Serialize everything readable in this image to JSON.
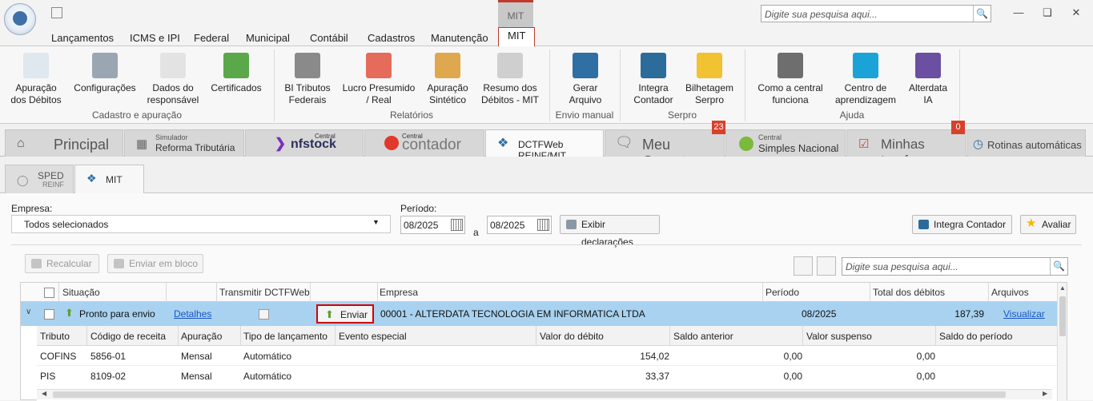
{
  "titlebar": {
    "search_placeholder": "Digite sua pesquisa aqui...",
    "context_tab": "MIT"
  },
  "menu": {
    "tabs": [
      "Lançamentos",
      "ICMS e IPI",
      "Federal",
      "Municipal",
      "Contábil",
      "Cadastros",
      "Manutenção",
      "MIT"
    ],
    "active": "MIT"
  },
  "ribbon": {
    "buttons": [
      {
        "l1": "Apuração",
        "l2": "dos Débitos",
        "icon": "document-nf-icon",
        "color": "#dfe7ef"
      },
      {
        "l1": "Configurações",
        "l2": "",
        "icon": "database-icon",
        "color": "#9aa6b2"
      },
      {
        "l1": "Dados do",
        "l2": "responsável",
        "icon": "document-icon",
        "color": "#e3e3e3"
      },
      {
        "l1": "Certificados",
        "l2": "",
        "icon": "certificate-icon",
        "color": "#5ba84a"
      },
      {
        "l1": "BI Tributos",
        "l2": "Federais",
        "icon": "bi-icon",
        "color": "#8a8a8a"
      },
      {
        "l1": "Lucro Presumido",
        "l2": "/ Real",
        "icon": "trend-chart-icon",
        "color": "#e56b5b"
      },
      {
        "l1": "Apuração",
        "l2": "Sintético",
        "icon": "edit-document-icon",
        "color": "#e0a84e"
      },
      {
        "l1": "Resumo dos",
        "l2": "Débitos - MIT",
        "icon": "documents-icon",
        "color": "#cfcfcf"
      },
      {
        "l1": "Gerar",
        "l2": "Arquivo",
        "icon": "reinf-logo-icon",
        "color": "#2f6fa3"
      },
      {
        "l1": "Integra",
        "l2": "Contador",
        "icon": "integra-icon",
        "color": "#2b6c9a"
      },
      {
        "l1": "Bilhetagem",
        "l2": "Serpro",
        "icon": "billing-icon",
        "color": "#f1c232"
      },
      {
        "l1": "Como a central",
        "l2": "funciona",
        "icon": "help-icon",
        "color": "#6e6e6e"
      },
      {
        "l1": "Centro de",
        "l2": "aprendizagem",
        "icon": "learning-icon",
        "color": "#1aa3d6"
      },
      {
        "l1": "Alterdata",
        "l2": "IA",
        "icon": "ai-icon",
        "color": "#6b4fa0"
      }
    ],
    "groups": [
      "Cadastro e apuração",
      "Relatórios",
      "Envio manual",
      "Serpro",
      "Ajuda"
    ]
  },
  "bigtabs": {
    "principal": "Principal",
    "simulador_small": "Simulador",
    "simulador": "Reforma Tributária",
    "nfstock_small": "Central",
    "nfstock": "nfstock",
    "contador_small": "Central",
    "contador": "contador",
    "dctf": "DCTFWeb REINF/MIT",
    "gerente": "Meu Gerente",
    "gerente_badge": "23",
    "simples_small": "Central",
    "simples": "Simples Nacional",
    "tarefas": "Minhas tarefas",
    "tarefas_badge": "0",
    "rotinas": "Rotinas automáticas"
  },
  "subtabs": {
    "sped1": "SPED",
    "sped2": "REINF",
    "mit": "MIT"
  },
  "filters": {
    "empresa_label": "Empresa:",
    "empresa_value": "Todos selecionados",
    "periodo_label": "Período:",
    "date_from": "08/2025",
    "sep": "a",
    "date_to": "08/2025",
    "exibir": "Exibir declarações",
    "integra": "Integra Contador",
    "avaliar": "Avaliar"
  },
  "toolbar": {
    "recalcular": "Recalcular",
    "enviar_bloco": "Enviar em bloco",
    "search_placeholder": "Digite sua pesquisa aqui..."
  },
  "grid": {
    "headers": [
      "Situação",
      "Transmitir DCTFWeb",
      "Empresa",
      "Período",
      "Total dos débitos",
      "Arquivos"
    ],
    "row": {
      "situacao": "Pronto para envio",
      "detalhes": "Detalhes",
      "enviar": "Enviar",
      "empresa": "00001 - ALTERDATA TECNOLOGIA EM INFORMATICA LTDA",
      "periodo": "08/2025",
      "total": "187,39",
      "arquivos": "Visualizar"
    },
    "sub_headers": [
      "Tributo",
      "Código de receita",
      "Apuração",
      "Tipo de lançamento",
      "Evento especial",
      "Valor do débito",
      "Saldo anterior",
      "Valor suspenso",
      "Saldo do período"
    ],
    "sub_rows": [
      {
        "tributo": "COFINS",
        "codigo": "5856-01",
        "apuracao": "Mensal",
        "tipo": "Automático",
        "evento": "",
        "valor": "154,02",
        "saldo_ant": "0,00",
        "suspenso": "0,00",
        "saldo_per": ""
      },
      {
        "tributo": "PIS",
        "codigo": "8109-02",
        "apuracao": "Mensal",
        "tipo": "Automático",
        "evento": "",
        "valor": "33,37",
        "saldo_ant": "0,00",
        "suspenso": "0,00",
        "saldo_per": ""
      }
    ]
  }
}
